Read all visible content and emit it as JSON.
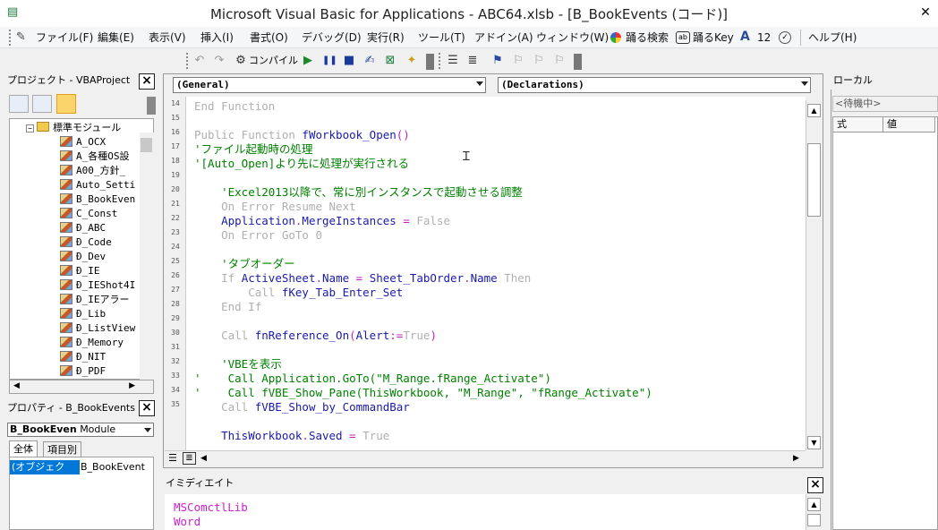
{
  "window": {
    "title": "Microsoft Visual Basic for Applications - ABC64.xlsb - [B_BookEvents (コード)]",
    "close_glyph": "✕"
  },
  "menu": [
    "ファイル(F)",
    "編集(E)",
    "表示(V)",
    "挿入(I)",
    "書式(O)",
    "デバッグ(D)",
    "実行(R)",
    "ツール(T)",
    "アドイン(A)",
    "ウィンドウ(W)",
    "踊る検索",
    "踊るKey",
    "12",
    "ヘルプ(H)"
  ],
  "menu_badges": {
    "search_icon_label": "踊る検索",
    "key_icon_label": "ab",
    "font_icon_label": "A"
  },
  "toolbar": {
    "compile_label": "コンパイル"
  },
  "project_panel": {
    "title": "プロジェクト - VBAProject",
    "folder_label": "標準モジュール",
    "modules": [
      "A_OCX",
      "A_各種OS設",
      "A00_方針_",
      "Auto_Setti",
      "B_BookEven",
      "C_Const",
      "Ð_ABC",
      "Ð_Code",
      "Ð_Dev",
      "Ð_IE",
      "Ð_IEShot4I",
      "Ð_IEアラー",
      "Ð_Lib",
      "Ð_ListView",
      "Ð_Memory",
      "Ð_NIT",
      "Ð_PDF"
    ]
  },
  "properties_panel": {
    "title": "プロパティ - B_BookEvents",
    "object_name": "B_BookEven",
    "object_type": "Module",
    "tab_all": "全体",
    "tab_category": "項目別",
    "row_name": "(オブジェク",
    "row_value": "B_BookEvent"
  },
  "code_window": {
    "object_combo": "(General)",
    "proc_combo": "(Declarations)",
    "line_numbers": [
      "14",
      "15",
      "16",
      "17",
      "18",
      "19",
      "20",
      "21",
      "22",
      "23",
      "24",
      "25",
      "26",
      "27",
      "28",
      "29",
      "30",
      "31",
      "32",
      "33",
      "34",
      "35"
    ],
    "lines": {
      "l0": "End Function",
      "l1_kw": "Public Function ",
      "l1_id": "fWorkbook_Open",
      "l1_rest": "()",
      "l2": "'ファイル起動時の処理",
      "l3": "'[Auto_Open]より先に処理が実行される",
      "l4": "    'Excel2013以降で、常に別インスタンスで起動させる調整",
      "l5": "    On Error Resume Next",
      "l6_a": "    Application",
      "l6_b": ".",
      "l6_c": "MergeInstances",
      "l6_d": " = ",
      "l6_e": "False",
      "l7": "    On Error GoTo 0",
      "l8": "    'タブオーダー",
      "l9_kw": "    If ",
      "l9_a": "ActiveSheet",
      "l9_b": ".",
      "l9_c": "Name",
      "l9_d": " = ",
      "l9_e": "Sheet_TabOrder",
      "l9_f": ".",
      "l9_g": "Name",
      "l9_h": " Then",
      "l10_kw": "        Call ",
      "l10_a": "fKey_Tab_Enter_Set",
      "l11": "    End If",
      "l12_kw": "    Call ",
      "l12_a": "fnReference_On",
      "l12_b": "(",
      "l12_c": "Alert",
      "l12_d": ":=",
      "l12_e": "True",
      "l12_f": ")",
      "l13": "    'VBEを表示",
      "l14": "'    Call Application.GoTo(\"M_Range.fRange_Activate\")",
      "l15": "'    Call fVBE_Show_Pane(ThisWorkbook, \"M_Range\", \"fRange_Activate\")",
      "l16_kw": "    Call ",
      "l16_a": "fVBE_Show_by_CommandBar",
      "l17_a": "    ThisWorkbook",
      "l17_b": ".",
      "l17_c": "Saved",
      "l17_d": " = ",
      "l17_e": "True"
    }
  },
  "immediate": {
    "title": "イミディエイト",
    "lines": [
      "MSComctlLib",
      "Word"
    ]
  },
  "locals": {
    "title": "ローカル",
    "status": "<待機中>",
    "col_expr": "式",
    "col_value": "値"
  },
  "colors": {
    "keyword": "#b0b0b0",
    "comment": "#008000",
    "identifier": "#1a1aaa",
    "operator": "#c020c0"
  }
}
